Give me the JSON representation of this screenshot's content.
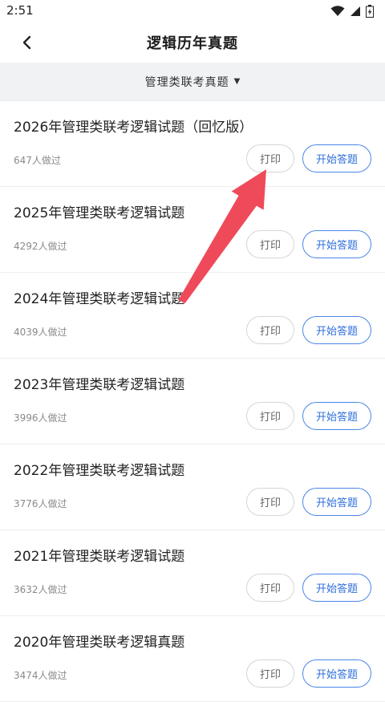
{
  "status_bar": {
    "time": "2:51",
    "icons": [
      "wifi-icon",
      "signal-icon",
      "battery-icon"
    ]
  },
  "header": {
    "title": "逻辑历年真题",
    "back_icon": "chevron-left-icon"
  },
  "filter": {
    "label": "管理类联考真题",
    "caret_icon": "caret-down-icon"
  },
  "items": [
    {
      "title": "2026年管理类联考逻辑试题（回忆版）",
      "count": "647人做过",
      "print_label": "打印",
      "start_label": "开始答题"
    },
    {
      "title": "2025年管理类联考逻辑试题",
      "count": "4292人做过",
      "print_label": "打印",
      "start_label": "开始答题"
    },
    {
      "title": "2024年管理类联考逻辑试题",
      "count": "4039人做过",
      "print_label": "打印",
      "start_label": "开始答题"
    },
    {
      "title": "2023年管理类联考逻辑试题",
      "count": "3996人做过",
      "print_label": "打印",
      "start_label": "开始答题"
    },
    {
      "title": "2022年管理类联考逻辑试题",
      "count": "3776人做过",
      "print_label": "打印",
      "start_label": "开始答题"
    },
    {
      "title": "2021年管理类联考逻辑试题",
      "count": "3632人做过",
      "print_label": "打印",
      "start_label": "开始答题"
    },
    {
      "title": "2020年管理类联考逻辑真题",
      "count": "3474人做过",
      "print_label": "打印",
      "start_label": "开始答题"
    }
  ],
  "colors": {
    "accent": "#2f6fdc",
    "annotation_arrow": "#ef4a5a",
    "filter_bg": "#f1f2f4"
  }
}
